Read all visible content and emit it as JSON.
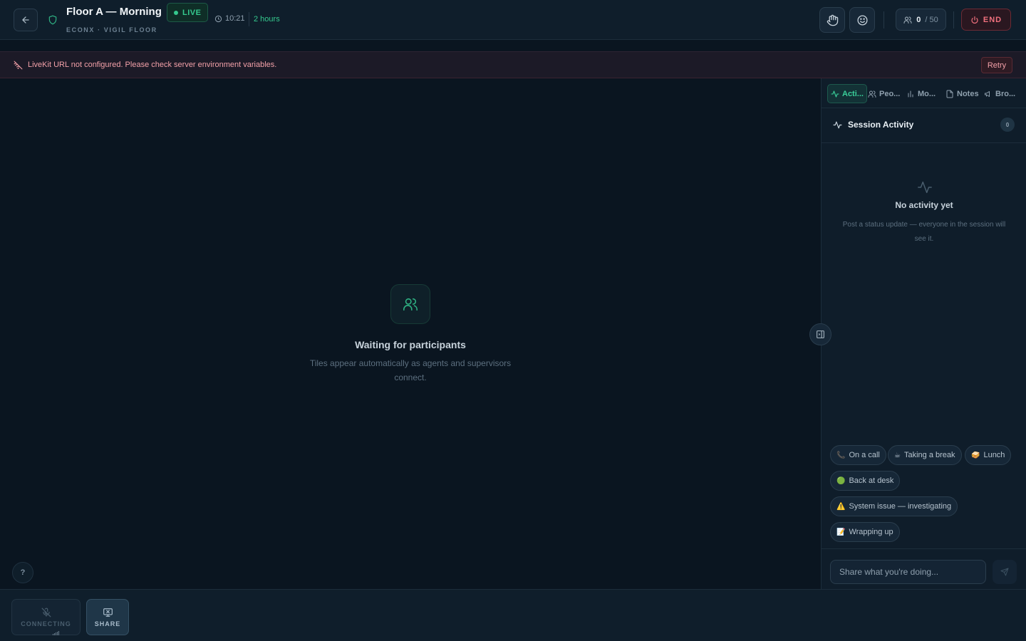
{
  "header": {
    "title": "Floor A — Morning",
    "live_label": "LIVE",
    "subtitle": "ECONX · VIGIL FLOOR",
    "clock": "10:21",
    "duration": "2 hours",
    "participant_count": "0",
    "participant_max": "/ 50",
    "end_label": "END",
    "icons": {
      "back": "arrow-left-icon",
      "shield": "shield-icon",
      "clock": "clock-icon",
      "hand": "raise-hand-icon",
      "reaction": "smile-icon",
      "users": "users-icon",
      "power": "power-icon"
    }
  },
  "alert": {
    "message": "LiveKit URL not configured. Please check server environment variables.",
    "retry_label": "Retry"
  },
  "stage": {
    "waiting_title": "Waiting for participants",
    "waiting_subtitle": "Tiles appear automatically as agents and supervisors connect.",
    "help_label": "?"
  },
  "sidebar": {
    "tabs": [
      {
        "label": "Acti...",
        "icon": "activity-icon",
        "active": true
      },
      {
        "label": "Peo...",
        "icon": "users-icon",
        "active": false
      },
      {
        "label": "Mo...",
        "icon": "bar-chart-icon",
        "active": false
      },
      {
        "label": "Notes",
        "icon": "file-icon",
        "active": false
      },
      {
        "label": "Bro...",
        "icon": "megaphone-icon",
        "active": false
      }
    ],
    "activity_title": "Session Activity",
    "activity_count": "0",
    "empty_title": "No activity yet",
    "empty_subtitle": "Post a status update — everyone in the session will see it.",
    "quick_statuses": [
      {
        "emoji": "📞",
        "label": "On a call"
      },
      {
        "emoji": "☕",
        "label": "Taking a break"
      },
      {
        "emoji": "🥪",
        "label": "Lunch"
      },
      {
        "emoji": "🟢",
        "label": "Back at desk"
      },
      {
        "emoji": "⚠️",
        "label": "System issue — investigating"
      },
      {
        "emoji": "📝",
        "label": "Wrapping up"
      }
    ],
    "input_placeholder": "Share what you're doing..."
  },
  "controls": {
    "connecting_label": "CONNECTING",
    "share_label": "SHARE"
  },
  "colors": {
    "accent": "#35c98e",
    "danger": "#f0707d",
    "background": "#0a1520",
    "panel": "#0f1d2a"
  }
}
